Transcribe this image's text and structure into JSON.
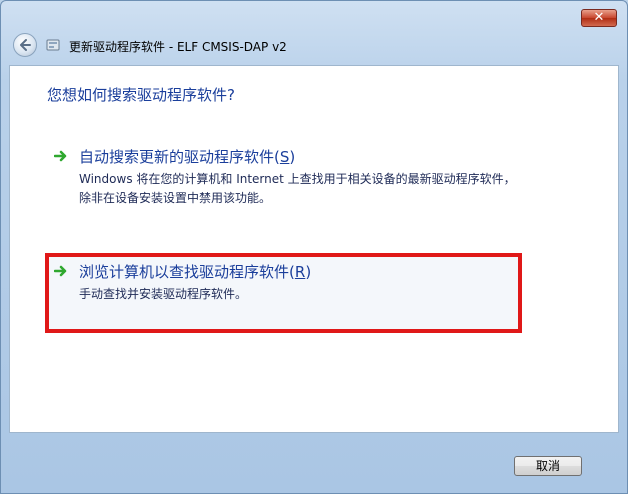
{
  "window": {
    "title": "更新驱动程序软件 - ELF CMSIS-DAP v2",
    "close_label": "✕"
  },
  "main": {
    "heading": "您想如何搜索驱动程序软件?",
    "options": [
      {
        "title": "自动搜索更新的驱动程序软件",
        "shortcut": "S",
        "desc": "Windows 将在您的计算机和 Internet 上查找用于相关设备的最新驱动程序软件，除非在设备安装设置中禁用该功能。",
        "icon": "green-arrow-icon"
      },
      {
        "title": "浏览计算机以查找驱动程序软件",
        "shortcut": "R",
        "desc": "手动查找并安装驱动程序软件。",
        "icon": "green-arrow-icon",
        "highlighted": true,
        "highlight_color": "#e01818"
      }
    ]
  },
  "footer": {
    "cancel_label": "取消"
  },
  "colors": {
    "link_blue": "#1a3e9b",
    "accent_red": "#e01818"
  }
}
